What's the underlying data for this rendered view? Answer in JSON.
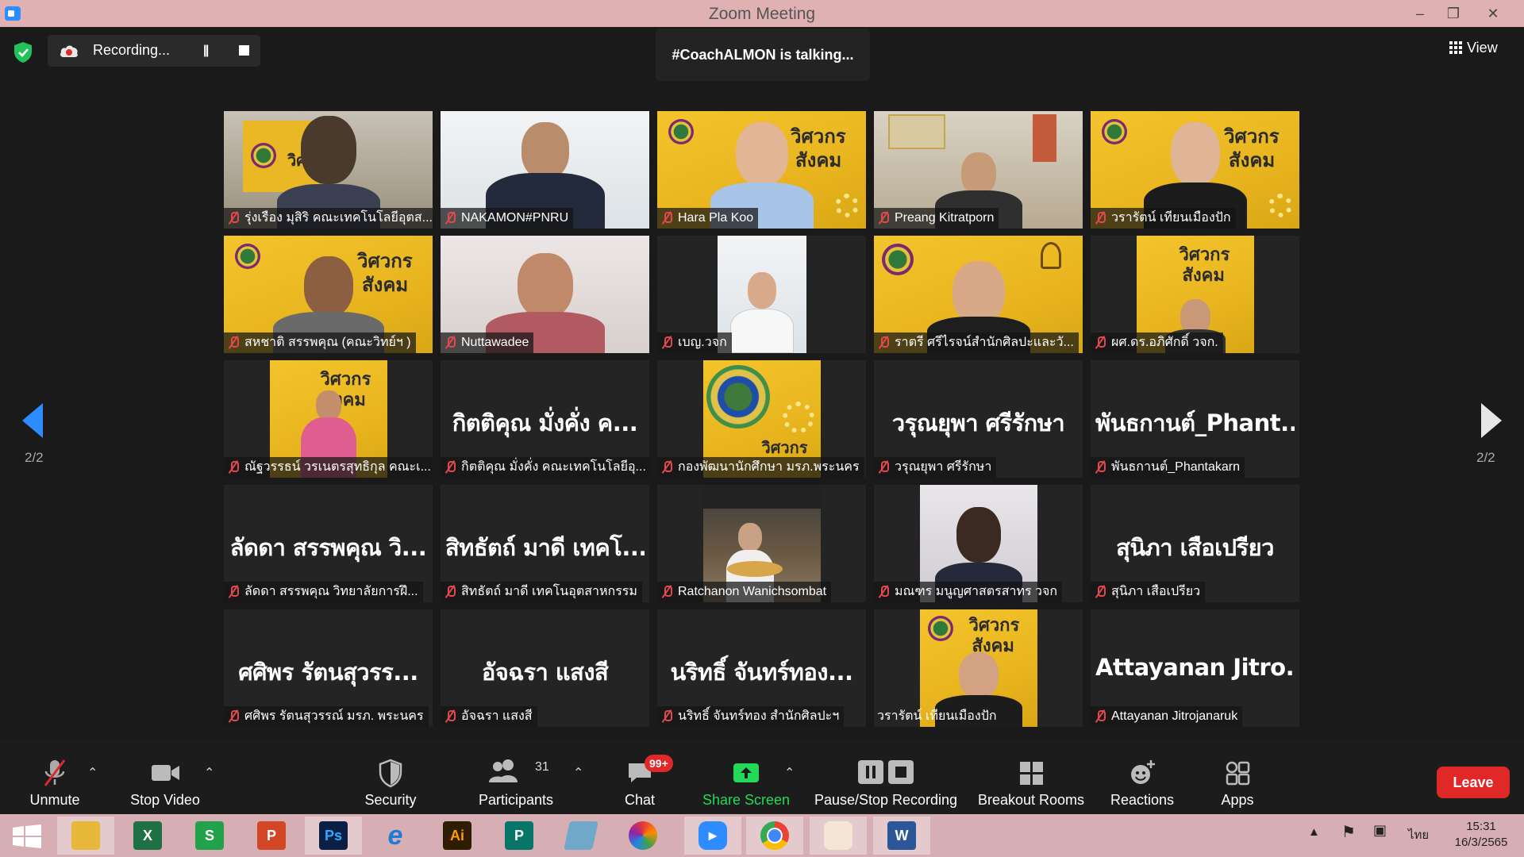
{
  "window": {
    "title": "Zoom Meeting"
  },
  "recording": {
    "label": "Recording..."
  },
  "talking": {
    "text": "#CoachALMON is talking..."
  },
  "view": {
    "label": "View"
  },
  "pagination": {
    "left": "2/2",
    "right": "2/2"
  },
  "tiles": [
    {
      "name": "รุ่งเรือง มุสิริ คณะเทคโนโลยีอุตส...",
      "big": ""
    },
    {
      "name": "NAKAMON#PNRU",
      "big": ""
    },
    {
      "name": "Hara Pla Koo",
      "big": ""
    },
    {
      "name": "Preang Kitratporn",
      "big": ""
    },
    {
      "name": "วรารัตน์ เทียนเมืองปัก",
      "big": ""
    },
    {
      "name": "สหชาติ สรรพคุณ (คณะวิทย์ฯ )",
      "big": ""
    },
    {
      "name": "Nuttawadee",
      "big": ""
    },
    {
      "name": "เบญ.วจก",
      "big": ""
    },
    {
      "name": "ราตรี  ศรีไรจน์สำนักศิลปะและวั...",
      "big": ""
    },
    {
      "name": "ผศ.ดร.อภิศักดิ์ วจก.",
      "big": ""
    },
    {
      "name": "ณัฐวรรธน์ วรเนตรสุทธิกุล คณะเ...",
      "big": ""
    },
    {
      "name": "กิตติคุณ  มั่งคั่ง คณะเทคโนโลยีอุ...",
      "big": "กิตติคุณ  มั่งคั่ง ค..."
    },
    {
      "name": "กองพัฒนานักศึกษา มรภ.พระนคร",
      "big": ""
    },
    {
      "name": "วรุณยุพา ศรีรักษา",
      "big": "วรุณยุพา ศรีรักษา"
    },
    {
      "name": "พันธกานต์_Phantakarn",
      "big": "พันธกานต์_Phant..."
    },
    {
      "name": "ลัดดา สรรพคุณ วิทยาลัยการฝึ...",
      "big": "ลัดดา สรรพคุณ วิ..."
    },
    {
      "name": "สิทธัตถ์ มาดี เทคโนอุตสาหกรรม",
      "big": "สิทธัตถ์ มาดี เทคโ..."
    },
    {
      "name": "Ratchanon Wanichsombat",
      "big": ""
    },
    {
      "name": "มณฑร มนูญศาสตรสาทร วจก",
      "big": ""
    },
    {
      "name": "สุนิภา เสือเปรียว",
      "big": "สุนิภา เสือเปรียว"
    },
    {
      "name": "ศศิพร รัตนสุวรรณ์ มรภ. พระนคร",
      "big": "ศศิพร รัตนสุวรร..."
    },
    {
      "name": "อัจฉรา แสงสี",
      "big": "อัจฉรา แสงสี"
    },
    {
      "name": "นริทธิ์ จันทร์ทอง สำนักศิลปะฯ",
      "big": "นริทธิ์ จันทร์ทอง..."
    },
    {
      "name": "วรารัตน์ เทียนเมืองปัก",
      "big": ""
    },
    {
      "name": "Attayanan  Jitrojanaruk",
      "big": "Attayanan  Jitro..."
    }
  ],
  "banner": {
    "line1": "วิศวกร",
    "line2": "สังคม"
  },
  "toolbar": {
    "unmute": "Unmute",
    "stop_video": "Stop Video",
    "security": "Security",
    "participants": "Participants",
    "participants_count": "31",
    "chat": "Chat",
    "chat_badge": "99+",
    "share_screen": "Share Screen",
    "pause_stop_recording": "Pause/Stop Recording",
    "breakout_rooms": "Breakout Rooms",
    "reactions": "Reactions",
    "apps": "Apps",
    "leave": "Leave"
  },
  "taskbar": {
    "apps": [
      "start",
      "file-explorer",
      "excel",
      "sway",
      "powerpoint",
      "photoshop",
      "internet-explorer",
      "illustrator",
      "publisher",
      "notepad",
      "photoscape",
      "zoom",
      "chrome",
      "paint",
      "word"
    ],
    "ps_label": "Ps",
    "ai_label": "Ai",
    "time": "15:31",
    "date": "16/3/2565",
    "lang": "ไทย"
  },
  "colors": {
    "accent": "#2d8cff",
    "leave": "#e02828",
    "share": "#23d959",
    "titlebar": "#e0b1b3",
    "taskbar": "#d7aeb3",
    "banner": "#f4c42c"
  }
}
